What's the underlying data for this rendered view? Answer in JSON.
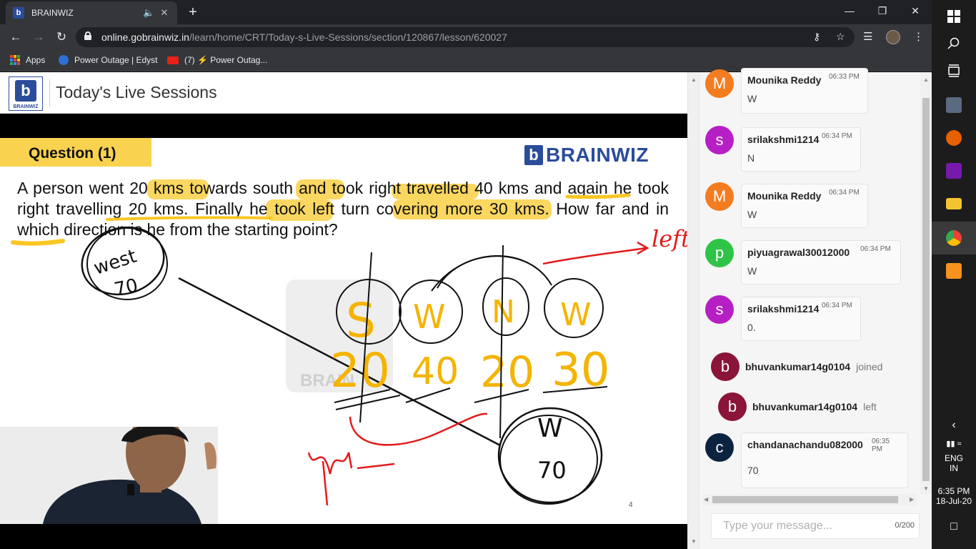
{
  "browser": {
    "tab_title": "BRAINWIZ",
    "tab_favicon": "b",
    "url_host": "online.gobrainwiz.in",
    "url_path": "/learn/home/CRT/Today-s-Live-Sessions/section/120867/lesson/620027",
    "bookmarks": [
      {
        "label": "Apps"
      },
      {
        "label": "Power Outage | Edyst"
      },
      {
        "label": "(7) ⚡ Power Outag..."
      }
    ]
  },
  "header": {
    "page_title": "Today's Live Sessions",
    "logo_text": "BRAINWIZ",
    "logo_letter": "b"
  },
  "slide": {
    "question_label": "Question (1)",
    "brand": "BRAINWIZ",
    "brand_letter": "b",
    "problem_text": "A person went 20 kms towards south and took right travelled 40 kms and again he took right travelling 20 kms. Finally he took left turn covering more 30 kms. How far and in which direction is he from the starting point?",
    "page_number": "4",
    "watermark_text": "BRAIN",
    "ink": {
      "circle_top_left": [
        "west",
        "70"
      ],
      "letters": [
        "S",
        "W",
        "N",
        "W"
      ],
      "numbers": [
        "20",
        "40",
        "20",
        "30"
      ],
      "circle_bottom_right": [
        "W",
        "70"
      ],
      "red_label": "left"
    }
  },
  "chat": {
    "messages": [
      {
        "type": "msg",
        "initial": "M",
        "color": "#f47c20",
        "name": "Mounika Reddy",
        "time": "06:33 PM",
        "text": "W"
      },
      {
        "type": "msg",
        "initial": "s",
        "color": "#b61fc4",
        "name": "srilakshmi1214",
        "time": "06:34 PM",
        "text": "N"
      },
      {
        "type": "msg",
        "initial": "M",
        "color": "#f47c20",
        "name": "Mounika Reddy",
        "time": "06:34 PM",
        "text": "W"
      },
      {
        "type": "msg",
        "initial": "p",
        "color": "#2fc347",
        "name": "piyuagrawal30012000",
        "time": "06:34 PM",
        "text": "W"
      },
      {
        "type": "msg",
        "initial": "s",
        "color": "#b61fc4",
        "name": "srilakshmi1214",
        "time": "06:34 PM",
        "text": "0."
      },
      {
        "type": "event",
        "initial": "b",
        "color": "#8a1538",
        "name": "bhuvankumar14g0104",
        "action": "joined"
      },
      {
        "type": "event",
        "initial": "b",
        "color": "#8a1538",
        "name": "bhuvankumar14g0104",
        "action": "left"
      },
      {
        "type": "msg",
        "initial": "c",
        "color": "#0c2340",
        "name": "chandanachandu082000",
        "time": "06:35 PM",
        "text": "70"
      }
    ],
    "input_placeholder": "Type your message...",
    "char_count": "0/200"
  },
  "taskbar": {
    "language": "ENG",
    "region": "IN",
    "time": "6:35 PM",
    "date": "18-Jul-20"
  }
}
